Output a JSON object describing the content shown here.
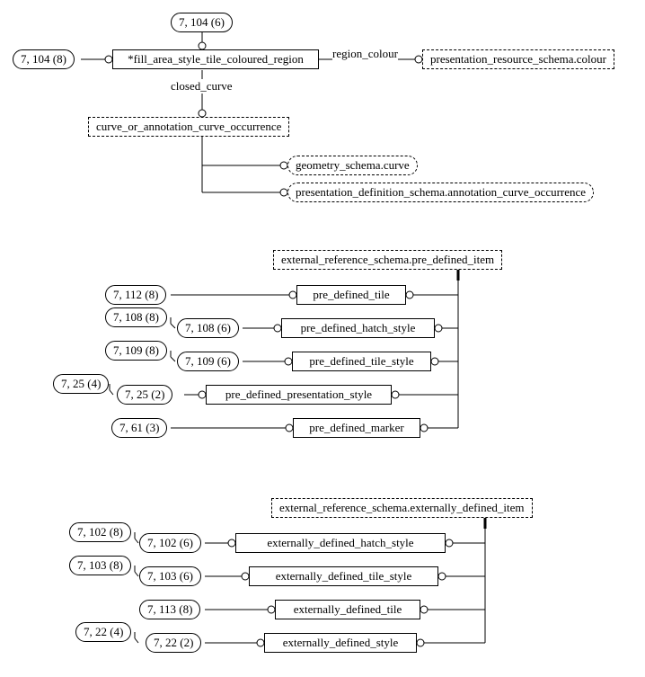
{
  "sec1": {
    "ref_top": "7, 104 (6)",
    "ref_left": "7, 104 (8)",
    "entity": "*fill_area_style_tile_coloured_region",
    "attr_region_colour": "region_colour",
    "attr_closed_curve": "closed_curve",
    "colour_box": "presentation_resource_schema.colour",
    "select_type": "curve_or_annotation_curve_occurrence",
    "geom_curve": "geometry_schema.curve",
    "anno_curve": "presentation_definition_schema.annotation_curve_occurrence"
  },
  "sec2": {
    "parent": "external_reference_schema.pre_defined_item",
    "rows": [
      {
        "refs": [
          "7, 112 (8)"
        ],
        "name": "pre_defined_tile"
      },
      {
        "refs": [
          "7, 108 (8)",
          "7, 108 (6)"
        ],
        "name": "pre_defined_hatch_style"
      },
      {
        "refs": [
          "7, 109 (8)",
          "7, 109 (6)"
        ],
        "name": "pre_defined_tile_style"
      },
      {
        "refs": [
          "7, 25 (4)",
          "7, 25 (2)"
        ],
        "name": "pre_defined_presentation_style"
      },
      {
        "refs": [
          "7, 61 (3)"
        ],
        "name": "pre_defined_marker"
      }
    ]
  },
  "sec3": {
    "parent": "external_reference_schema.externally_defined_item",
    "rows": [
      {
        "refs": [
          "7, 102 (8)",
          "7, 102 (6)"
        ],
        "name": "externally_defined_hatch_style"
      },
      {
        "refs": [
          "7, 103 (8)",
          "7, 103 (6)"
        ],
        "name": "externally_defined_tile_style"
      },
      {
        "refs": [
          "7, 113 (8)"
        ],
        "name": "externally_defined_tile"
      },
      {
        "refs": [
          "7, 22 (4)",
          "7, 22 (2)"
        ],
        "name": "externally_defined_style"
      }
    ]
  }
}
